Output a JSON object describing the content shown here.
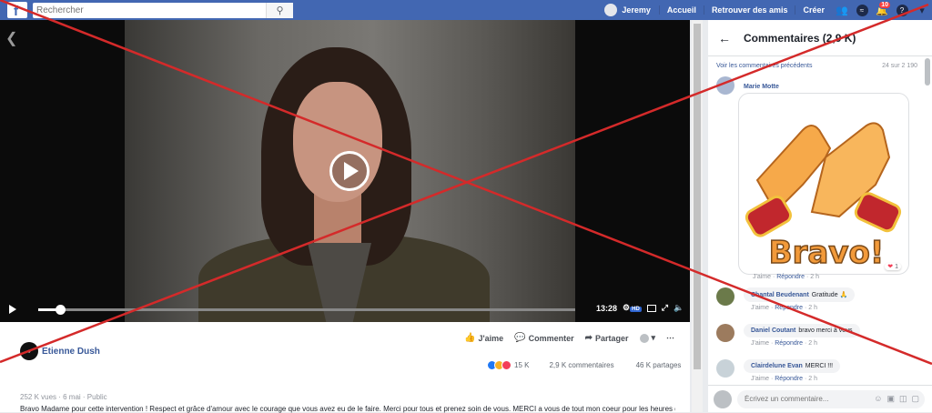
{
  "topbar": {
    "logo": "f",
    "search_placeholder": "Rechercher",
    "user_name": "Jeremy",
    "nav_links": [
      "Accueil",
      "Retrouver des amis",
      "Créer"
    ],
    "notifications_badge": "10"
  },
  "video": {
    "duration": "13:28",
    "hd_label": "HD",
    "progress_fraction": 0.04
  },
  "post": {
    "author": "Etienne Dush",
    "actions": {
      "like": "J'aime",
      "comment": "Commenter",
      "share": "Partager"
    },
    "reactions_count": "15 K",
    "comments_count": "2,9 K commentaires",
    "shares_count": "46 K partages",
    "meta": "252 K vues · 6 mai · Public",
    "description": "Bravo Madame pour cette intervention ! Respect et grâce d'amour avec le courage que vous avez eu de le faire. Merci pour tous et prenez soin de vous. MERCI a vous de tout mon coeur pour les heures que vous passez"
  },
  "comments_panel": {
    "title": "Commentaires (2,9 K)",
    "previous_link": "Voir les commentaires précédents",
    "count_label": "24 sur 2 190",
    "like_label": "J'aime",
    "reply_label": "Répondre",
    "gif_text": "Bravo!",
    "gif_reactions": "1",
    "comments": [
      {
        "name": "Marie Motte",
        "text": "",
        "time": "2 h"
      },
      {
        "name": "Chantal Beudenant",
        "text": "Gratitude 🙏",
        "time": "2 h"
      },
      {
        "name": "Daniel Coutant",
        "text": "bravo merci à vous",
        "time": "2 h"
      },
      {
        "name": "Clairdelune Evan",
        "text": "MERCI !!!",
        "time": "2 h"
      }
    ],
    "input_placeholder": "Écrivez un commentaire..."
  },
  "colors": {
    "brand": "#4267b2",
    "link": "#385898",
    "overlay_x": "#d42a2a"
  }
}
